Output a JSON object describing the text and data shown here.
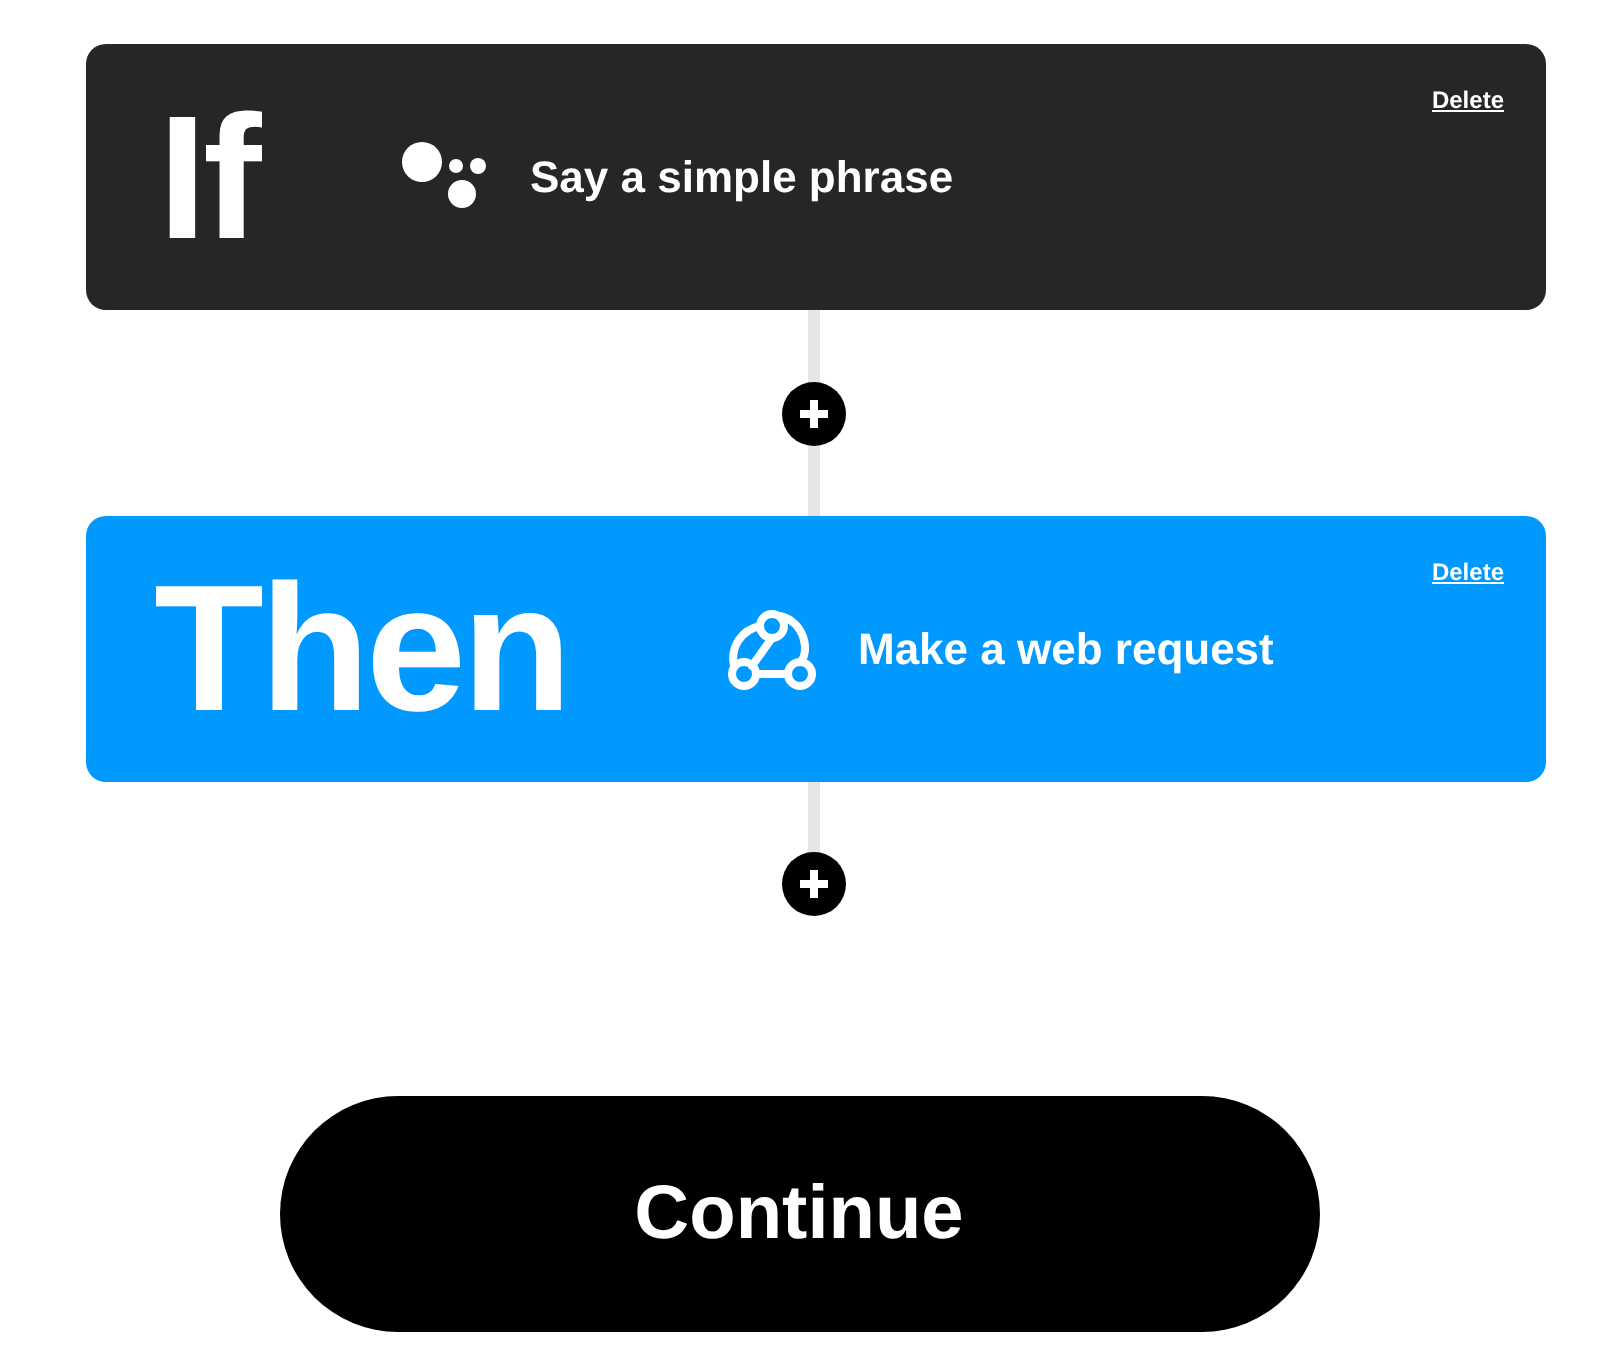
{
  "steps": [
    {
      "kind": "if",
      "keyword": "If",
      "service": "Say a simple phrase",
      "delete": "Delete"
    },
    {
      "kind": "then",
      "keyword": "Then",
      "service": "Make a web request",
      "delete": "Delete"
    }
  ],
  "continue": "Continue"
}
